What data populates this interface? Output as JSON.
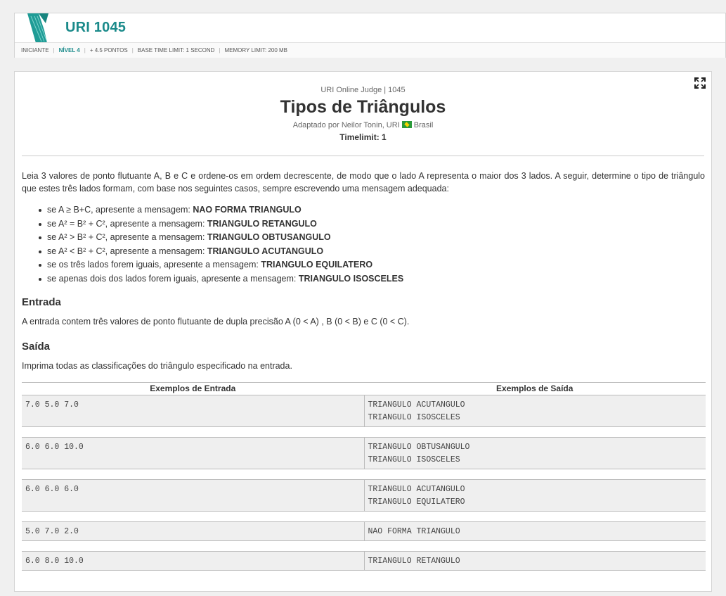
{
  "header": {
    "problem_id": "URI 1045",
    "meta": {
      "category": "INICIANTE",
      "level": "NÍVEL 4",
      "points": "+ 4.5 PONTOS",
      "time_limit": "BASE TIME LIMIT: 1 SECOND",
      "memory_limit": "MEMORY LIMIT: 200 MB"
    },
    "accent_color": "#1a8a8a"
  },
  "problem": {
    "judge_line": "URI Online Judge | 1045",
    "title": "Tipos de Triângulos",
    "author_prefix": "Adaptado por Neilor Tonin, URI",
    "author_country": "Brasil",
    "timelimit": "Timelimit: 1",
    "description": "Leia 3 valores de ponto flutuante A, B e C e ordene-os em ordem decrescente, de modo que o lado A representa o maior dos 3 lados. A seguir, determine o tipo de triângulo que estes três lados formam, com base nos seguintes casos, sempre escrevendo uma mensagem adequada:",
    "rules": [
      {
        "cond": "se A ≥ B+C, apresente a mensagem: ",
        "msg": "NAO FORMA TRIANGULO"
      },
      {
        "cond": "se A² = B² + C², apresente a mensagem: ",
        "msg": "TRIANGULO RETANGULO"
      },
      {
        "cond": "se A² > B² + C², apresente a mensagem: ",
        "msg": "TRIANGULO OBTUSANGULO"
      },
      {
        "cond": "se A² < B² + C², apresente a mensagem: ",
        "msg": "TRIANGULO ACUTANGULO"
      },
      {
        "cond": "se os três lados forem iguais, apresente a mensagem: ",
        "msg": "TRIANGULO EQUILATERO"
      },
      {
        "cond": "se apenas dois dos lados forem iguais, apresente a mensagem: ",
        "msg": "TRIANGULO ISOSCELES"
      }
    ],
    "input_heading": "Entrada",
    "input_text": "A entrada contem três valores de ponto flutuante de dupla precisão A (0 < A) , B (0 < B) e C (0 < C).",
    "output_heading": "Saída",
    "output_text": "Imprima todas as classificações do triângulo especificado na entrada."
  },
  "examples": {
    "input_header": "Exemplos de Entrada",
    "output_header": "Exemplos de Saída",
    "rows": [
      {
        "input": "7.0 5.0 7.0",
        "output": [
          "TRIANGULO ACUTANGULO",
          "TRIANGULO ISOSCELES"
        ]
      },
      {
        "input": "6.0 6.0 10.0",
        "output": [
          "TRIANGULO OBTUSANGULO",
          "TRIANGULO ISOSCELES"
        ]
      },
      {
        "input": "6.0 6.0 6.0",
        "output": [
          "TRIANGULO ACUTANGULO",
          "TRIANGULO EQUILATERO"
        ]
      },
      {
        "input": "5.0 7.0 2.0",
        "output": [
          "NAO FORMA TRIANGULO"
        ]
      },
      {
        "input": "6.0 8.0 10.0",
        "output": [
          "TRIANGULO RETANGULO"
        ]
      }
    ]
  }
}
